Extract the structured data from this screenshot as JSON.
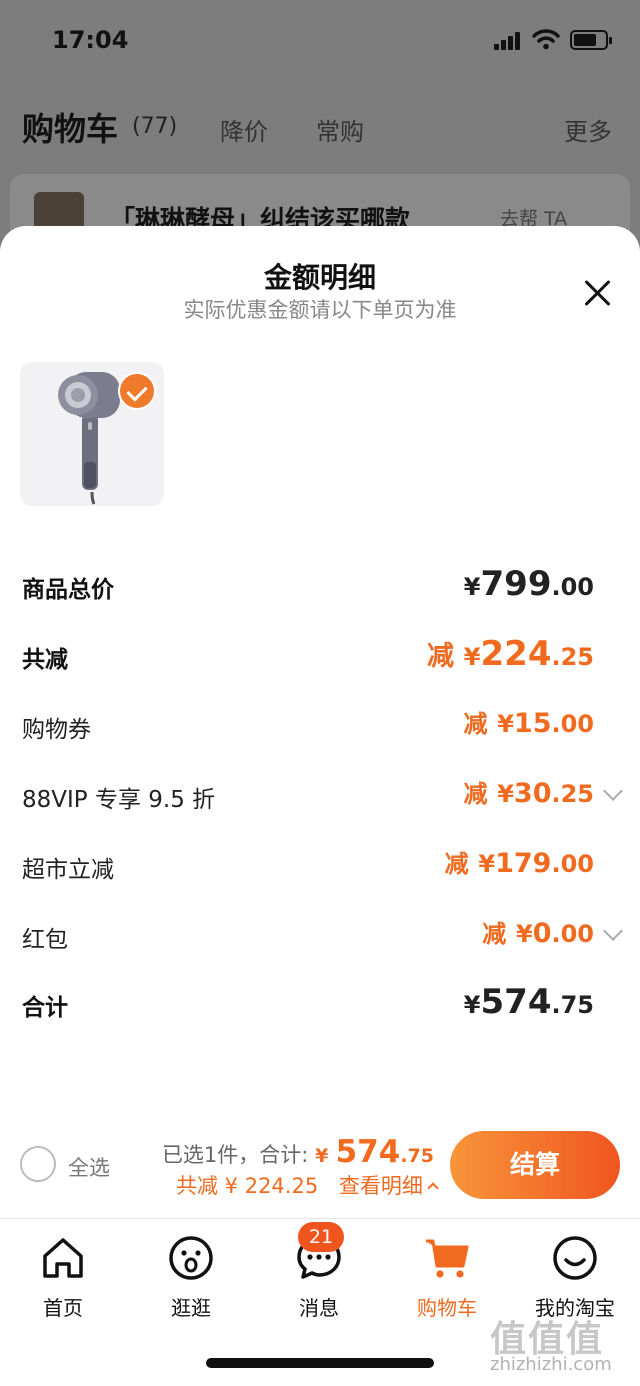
{
  "status_bar": {
    "time": "17:04"
  },
  "cart_header": {
    "title": "购物车",
    "count": "(77)",
    "tabs": [
      "降价",
      "常购"
    ],
    "more": "更多"
  },
  "banner": {
    "text": "「琳琳酵母」纠结该买哪款",
    "link": "去帮 TA"
  },
  "sheet": {
    "title": "金额明细",
    "subtitle": "实际优惠金额请以下单页为准"
  },
  "rows": [
    {
      "label": "商品总价",
      "prefix": "",
      "yen": "¥",
      "int": "799",
      "dec": ".00"
    },
    {
      "label": "共减",
      "prefix": "减",
      "yen": "¥",
      "int": "224",
      "dec": ".25"
    },
    {
      "label": "购物券",
      "prefix": "减",
      "yen": "¥",
      "int": "15",
      "dec": ".00"
    },
    {
      "label": "88VIP 专享 9.5 折",
      "prefix": "减",
      "yen": "¥",
      "int": "30",
      "dec": ".25"
    },
    {
      "label": "超市立减",
      "prefix": "减",
      "yen": "¥",
      "int": "179",
      "dec": ".00"
    },
    {
      "label": "红包",
      "prefix": "减",
      "yen": "¥",
      "int": "0",
      "dec": ".00"
    },
    {
      "label": "合计",
      "prefix": "",
      "yen": "¥",
      "int": "574",
      "dec": ".75"
    }
  ],
  "bottom_bar": {
    "select_all": "全选",
    "selected_text": "已选1件，合计:",
    "total_yen": "¥",
    "total_int": "574",
    "total_dec": ".75",
    "discount_text": "共减 ¥ 224.25",
    "detail_link": "查看明细",
    "checkout": "结算"
  },
  "tabbar": {
    "items": [
      "首页",
      "逛逛",
      "消息",
      "购物车",
      "我的淘宝"
    ],
    "message_badge": "21"
  },
  "watermark": {
    "logo": "值值值",
    "site": "zhizhizhi.com"
  },
  "colors": {
    "accent": "#f06a1f",
    "checkout_gradient_start": "#f8953a",
    "checkout_gradient_end": "#f0551f"
  }
}
